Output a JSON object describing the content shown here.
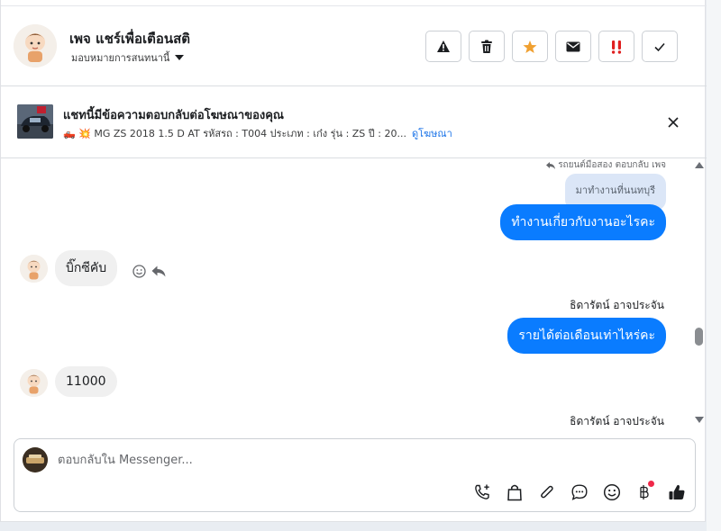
{
  "header": {
    "page_name": "เพจ แชร์เพื่อเตือนสติ",
    "assign_label": "มอบหมายการสนทนานี้",
    "actions": [
      {
        "name": "warning-icon",
        "label": "!"
      },
      {
        "name": "trash-icon",
        "label": ""
      },
      {
        "name": "star-icon",
        "label": "★"
      },
      {
        "name": "mail-icon",
        "label": ""
      },
      {
        "name": "double-exclaim-icon",
        "label": "!!"
      },
      {
        "name": "check-icon",
        "label": "✓"
      }
    ]
  },
  "ad": {
    "title": "แชทนี้มีข้อความตอบกลับต่อโฆษณาของคุณ",
    "description": "🛻 💥 MG ZS 2018 1.5 D AT รหัสรถ : T004 ประเภท : เก๋ง รุ่น : ZS ปี : 20...",
    "link": "ดูโฆษณา"
  },
  "messages": {
    "replied_note": "รถยนต์มือสอง ตอบกลับ เพจ",
    "quoted_text": "มาทำงานที่นนทบุรี",
    "out_1": "ทำงานเกี่ยวกับงานอะไรคะ",
    "in_1": "บิ๊กซีคับ",
    "sender_1": "ธิดารัตน์ อาจประจัน",
    "out_2": "รายได้ต่อเดือนเท่าไหร่คะ",
    "in_2": "11000",
    "sender_2": "ธิดารัตน์ อาจประจัน"
  },
  "composer": {
    "placeholder": "ตอบกลับใน Messenger...",
    "value": "",
    "tools": [
      "call-plus-icon",
      "bag-icon",
      "paperclip-icon",
      "chat-bubble-icon",
      "emoji-icon",
      "baht-icon",
      "thumbs-up-icon"
    ]
  },
  "colors": {
    "accent": "#0a7cff",
    "link": "#1a73e8",
    "notification": "#f02849",
    "star": "#f0a030",
    "danger": "#e02020"
  }
}
